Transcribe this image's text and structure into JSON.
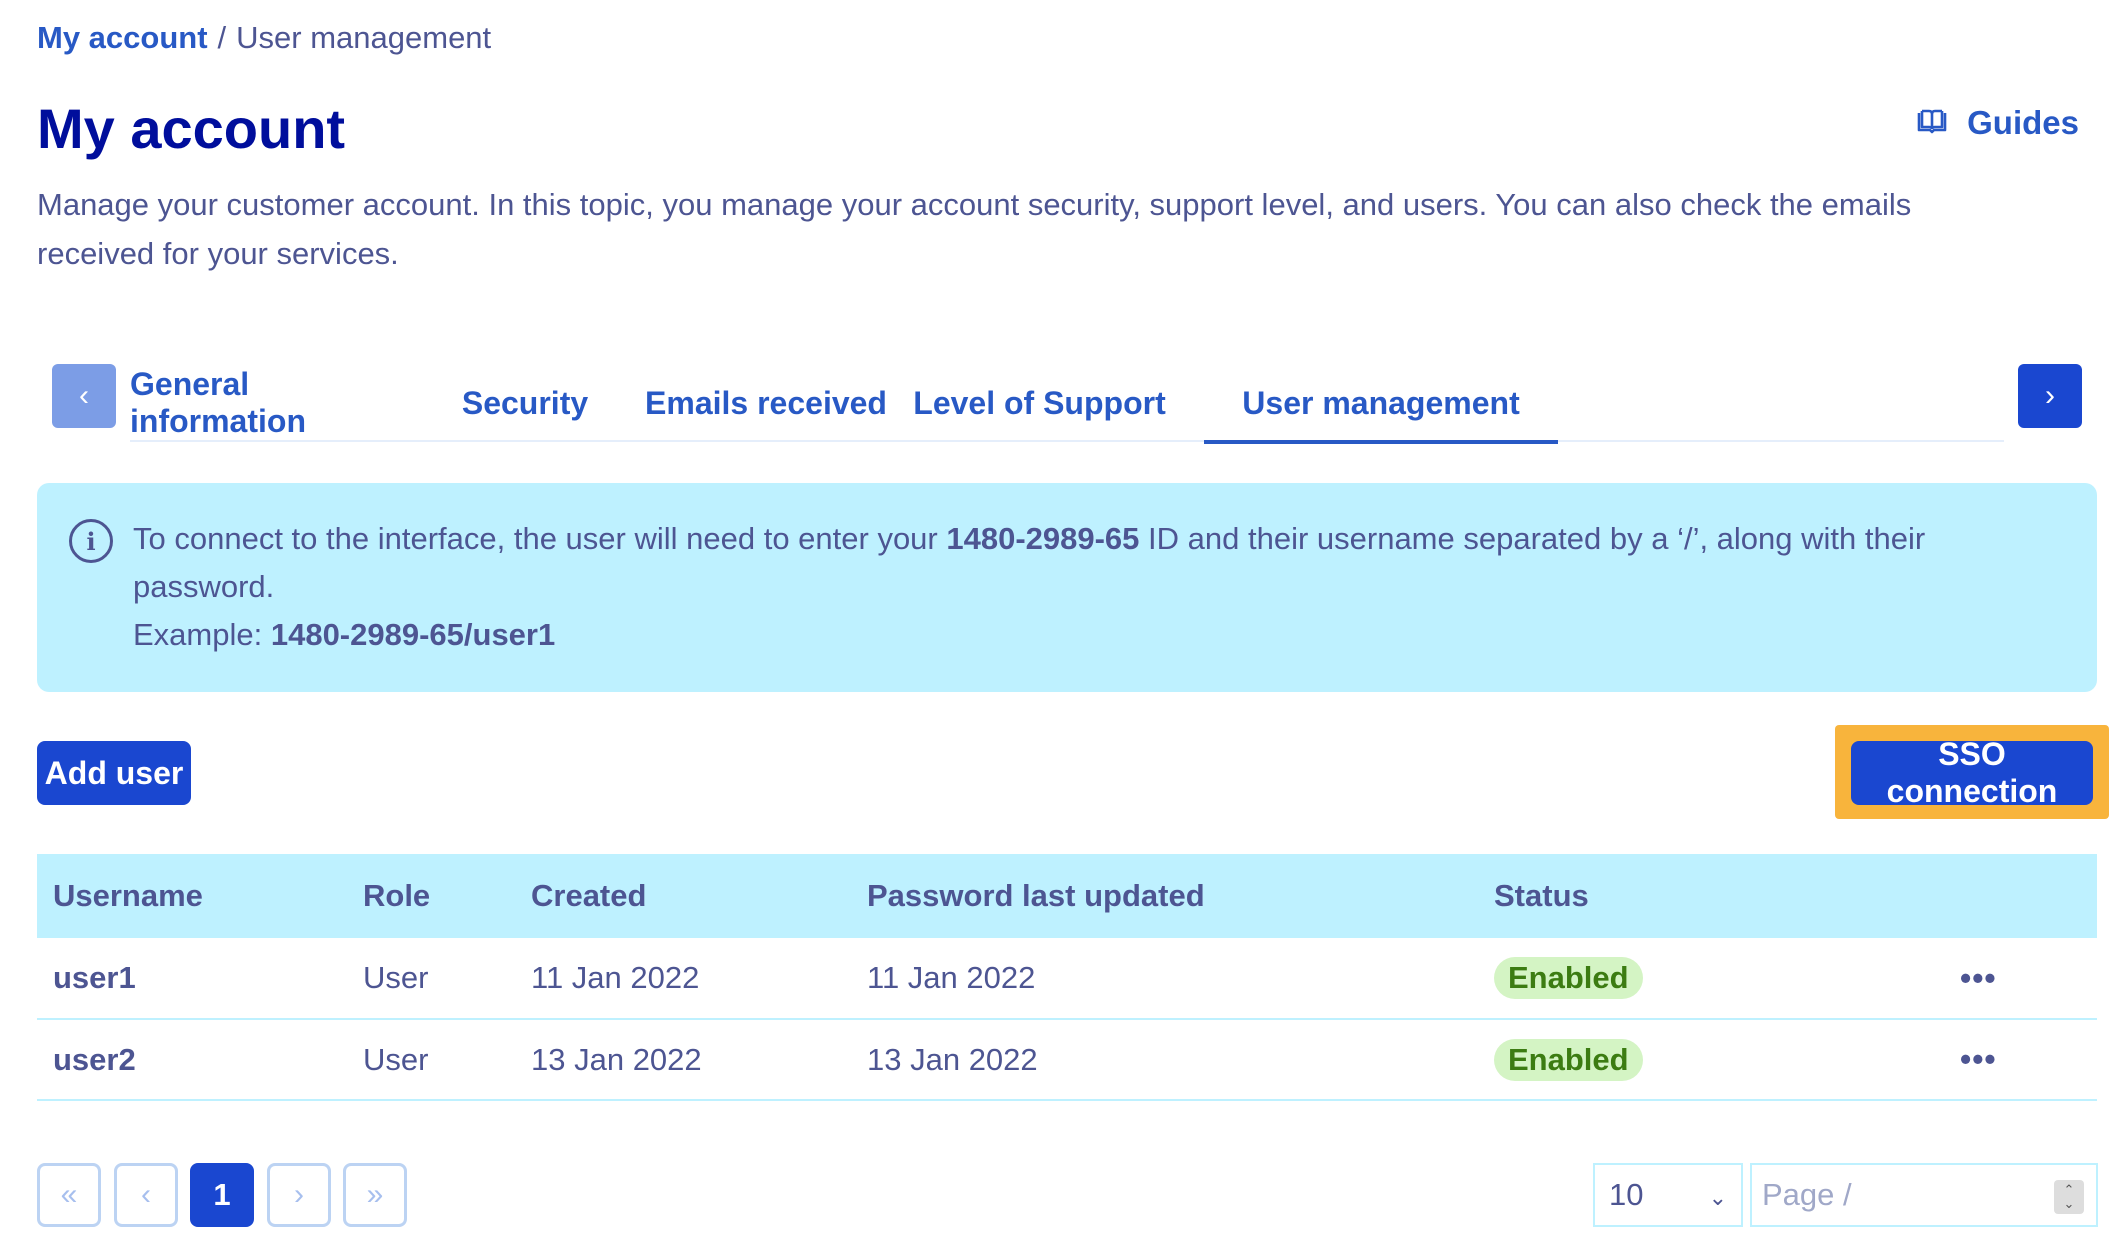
{
  "breadcrumb": {
    "parent": "My account",
    "separator": "/",
    "current": "User management"
  },
  "header": {
    "title": "My account",
    "guides_label": "Guides",
    "description": "Manage your customer account. In this topic, you manage your account security, support level, and users. You can also check the emails received for your services."
  },
  "tabs": {
    "prev_label": "‹",
    "next_label": "›",
    "items": [
      {
        "label": "General information"
      },
      {
        "label": "Security"
      },
      {
        "label": "Emails received"
      },
      {
        "label": "Level of Support"
      },
      {
        "label": "User management",
        "active": true
      }
    ]
  },
  "info": {
    "text_before": "To connect to the interface, the user will need to enter your ",
    "account_id": "1480-2989-65",
    "text_after": " ID and their username separated by a ‘/’, along with their password.",
    "example_label": "Example: ",
    "example_value": "1480-2989-65/user1"
  },
  "actions": {
    "add_user": "Add user",
    "sso": "SSO connection"
  },
  "table": {
    "columns": [
      "Username",
      "Role",
      "Created",
      "Password last updated",
      "Status"
    ],
    "rows": [
      {
        "username": "user1",
        "role": "User",
        "created": "11 Jan 2022",
        "password_updated": "11 Jan 2022",
        "status": "Enabled"
      },
      {
        "username": "user2",
        "role": "User",
        "created": "13 Jan 2022",
        "password_updated": "13 Jan 2022",
        "status": "Enabled"
      }
    ],
    "row_actions_label": "•••"
  },
  "pagination": {
    "first": "«",
    "prev": "‹",
    "current": "1",
    "next": "›",
    "last": "»",
    "page_size": "10",
    "page_placeholder": "Page /"
  },
  "colors": {
    "primary": "#1a47d0",
    "link": "#2859c5",
    "title": "#000e9c",
    "text": "#4d5592",
    "info_bg": "#bef1ff",
    "highlight": "#f8b43c",
    "status_bg": "#d4f4c4",
    "status_text": "#3c7c12"
  }
}
